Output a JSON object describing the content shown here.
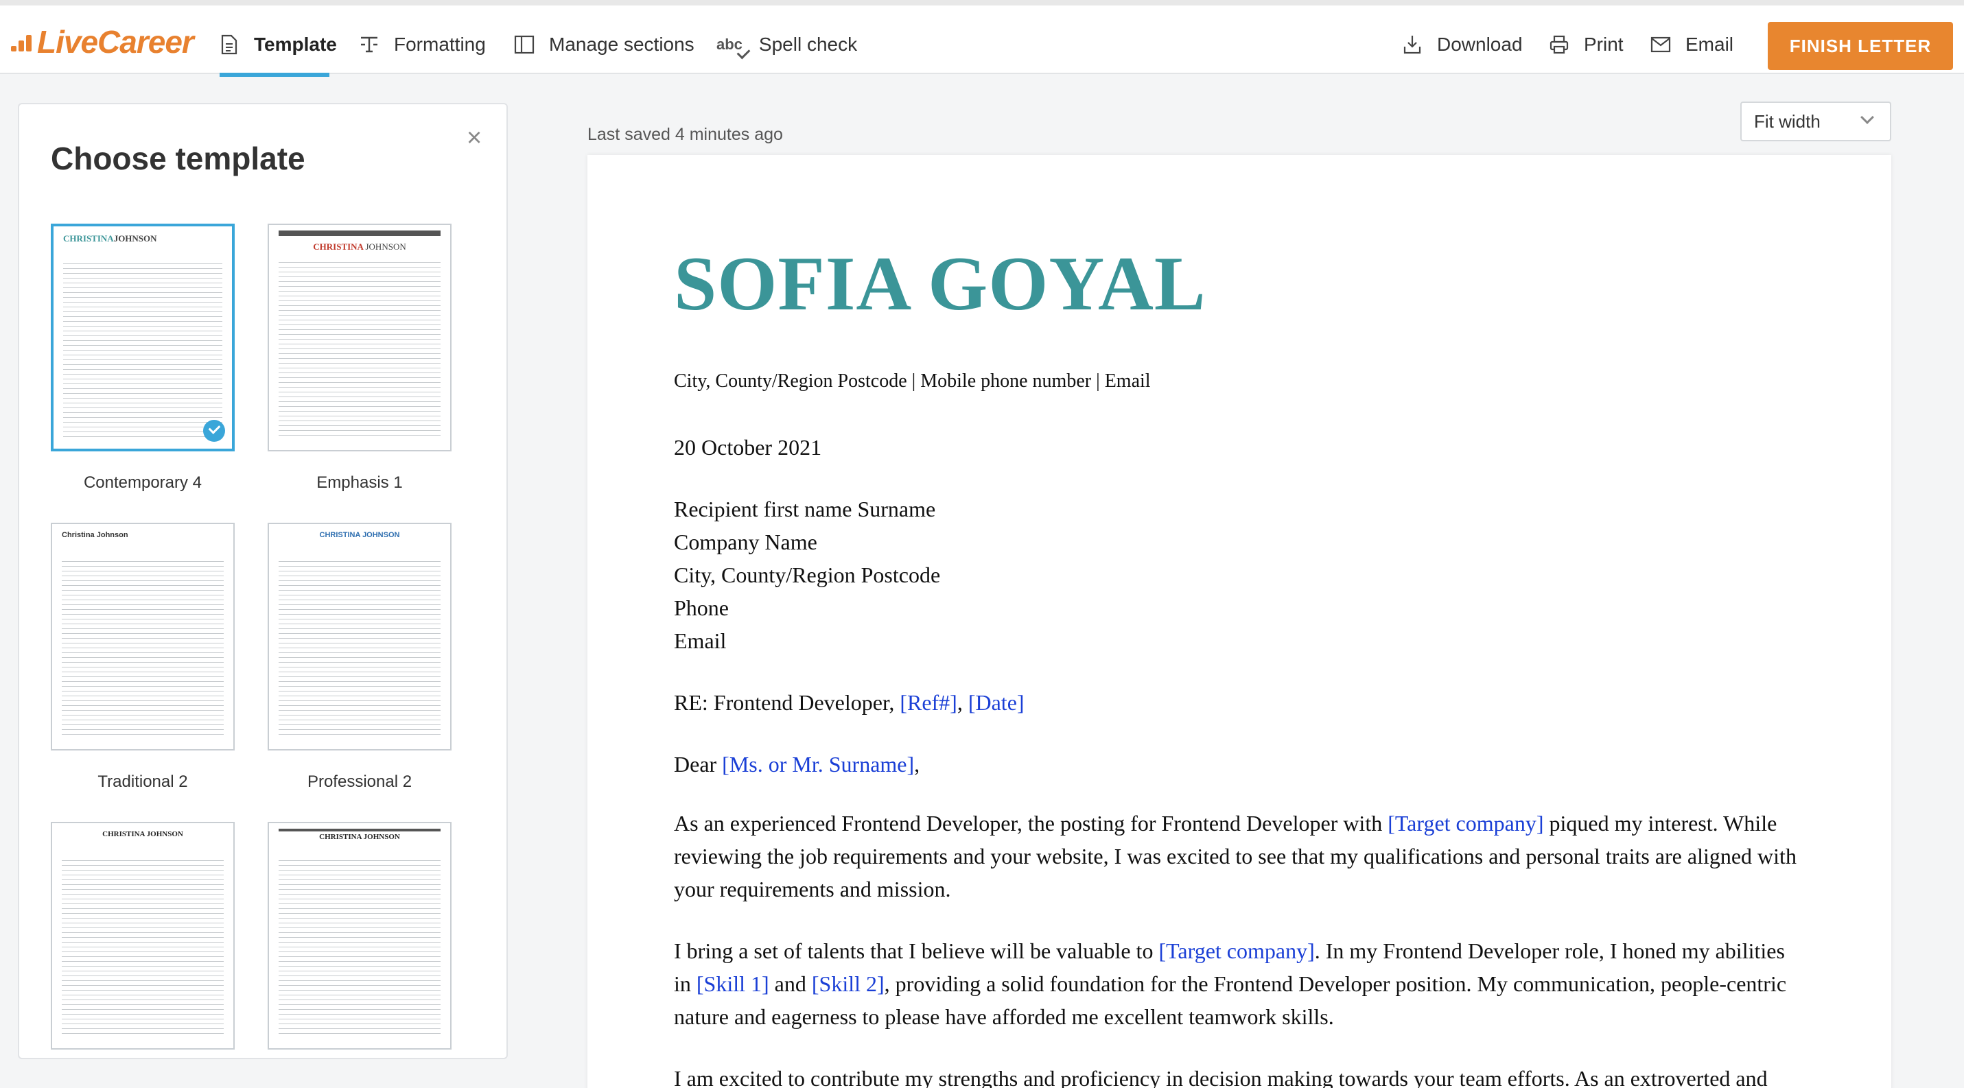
{
  "brand": {
    "logo_text": "LiveCareer",
    "accent": "#e8812f"
  },
  "nav": {
    "template": "Template",
    "formatting": "Formatting",
    "sections": "Manage sections",
    "spell_abc": "abc",
    "spell": "Spell check",
    "download": "Download",
    "print": "Print",
    "email": "Email",
    "finish": "FINISH LETTER"
  },
  "panel": {
    "title": "Choose template",
    "close": "×",
    "templates": [
      {
        "label": "Contemporary 4",
        "mini_first": "CHRISTINA",
        "mini_last": "JOHNSON",
        "selected": true
      },
      {
        "label": "Emphasis 1",
        "mini_first": "CHRISTINA",
        "mini_last": "JOHNSON"
      },
      {
        "label": "Traditional 2",
        "mini": "Christina Johnson"
      },
      {
        "label": "Professional 2",
        "mini": "CHRISTINA JOHNSON"
      },
      {
        "label": "",
        "mini": "CHRISTINA JOHNSON"
      },
      {
        "label": "",
        "mini": "CHRISTINA JOHNSON"
      }
    ]
  },
  "main": {
    "saved": "Last saved 4 minutes ago",
    "zoom": "Fit width"
  },
  "letter": {
    "name": "SOFIA GOYAL",
    "name_color": "#3b9598",
    "placeholder_color": "#1a3fd6",
    "contact": "City, County/Region Postcode | Mobile phone number | Email",
    "date": "20 October 2021",
    "recipient": [
      "Recipient first name Surname",
      "Company Name",
      "City, County/Region Postcode",
      "Phone",
      "Email"
    ],
    "re_prefix": "RE: Frontend Developer, ",
    "re_ref": "[Ref#]",
    "re_sep": ", ",
    "re_date": "[Date]",
    "dear_prefix": "Dear ",
    "dear_name": "[Ms. or Mr. Surname]",
    "dear_suffix": ",",
    "p1_a": "As an experienced Frontend Developer, the posting for Frontend Developer with ",
    "p1_company": "[Target company]",
    "p1_b": " piqued my interest. While reviewing the job requirements and your website, I was excited to see that my qualifications and personal traits are aligned with your requirements and mission.",
    "p2_a": "I bring a set of talents that I believe will be valuable to ",
    "p2_company": "[Target company]",
    "p2_b": ". In my Frontend Developer role, I honed my abilities in ",
    "p2_skill1": "[Skill 1]",
    "p2_and": " and ",
    "p2_skill2": "[Skill 2]",
    "p2_c": ", providing a solid foundation for the Frontend Developer position. My communication, people-centric nature and eagerness to please have afforded me excellent teamwork skills.",
    "p3": "I am excited to contribute my strengths and proficiency in decision making towards your team efforts. As an extroverted and"
  }
}
